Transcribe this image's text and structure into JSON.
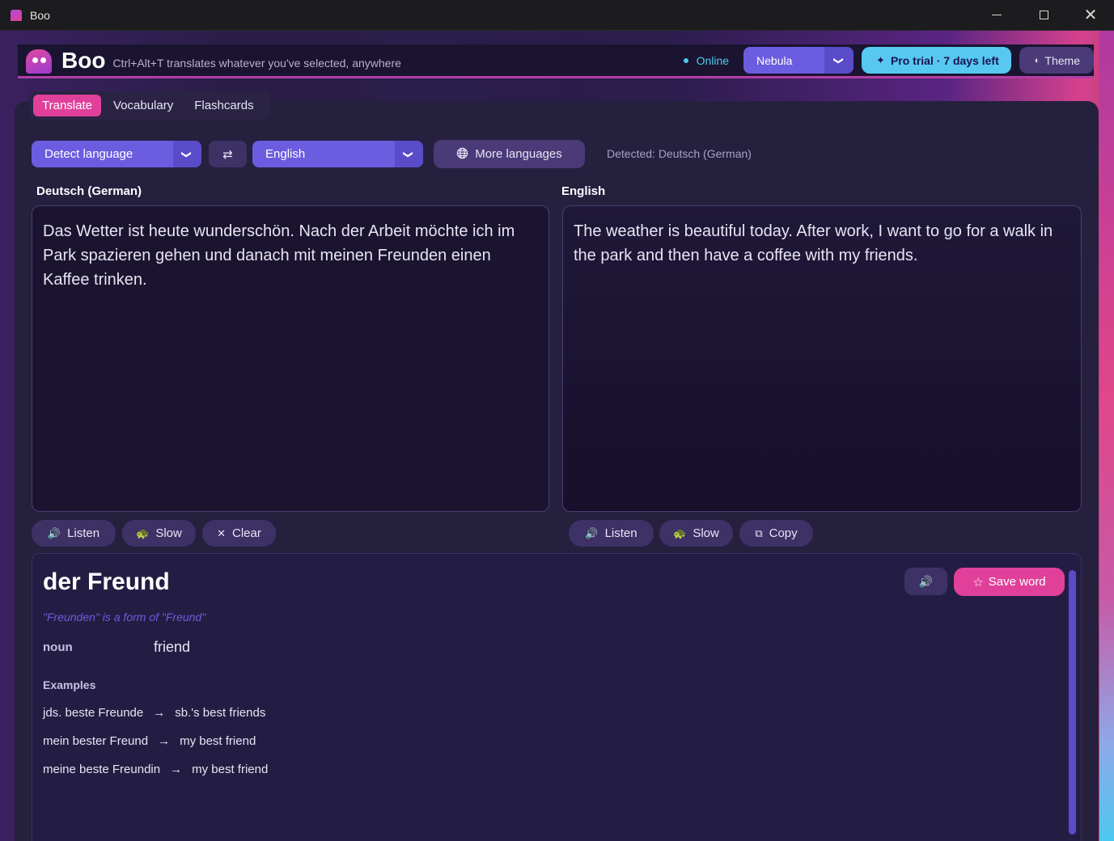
{
  "window": {
    "title": "Boo",
    "controls": {
      "minimize": "minimize-icon",
      "maximize": "maximize-icon",
      "close": "✕"
    }
  },
  "header": {
    "brand": "Boo",
    "tagline": "Ctrl+Alt+T translates whatever you've selected, anywhere",
    "status": "Online",
    "theme_select": "Nebula",
    "pro_label": "Pro trial · 7 days left",
    "theme_button": "Theme",
    "icons": {
      "spark": "✦",
      "half_circle": "◐",
      "chevron": "❯"
    }
  },
  "tabs": [
    {
      "label": "Translate",
      "active": true
    },
    {
      "label": "Vocabulary",
      "active": false
    },
    {
      "label": "Flashcards",
      "active": false
    }
  ],
  "lang_bar": {
    "source": "Detect language",
    "swap": "⇄",
    "target": "English",
    "more_languages": "More languages",
    "detected": "Detected: Deutsch (German)"
  },
  "source": {
    "label": "Deutsch (German)",
    "text": "Das Wetter ist heute wunderschön. Nach der Arbeit möchte ich im Park spazieren gehen und danach mit meinen Freunden einen Kaffee trinken.",
    "buttons": {
      "listen": "Listen",
      "slow": "Slow",
      "clear": "Clear"
    }
  },
  "target": {
    "label": "English",
    "text": "The weather is beautiful today. After work, I want to go for a walk in the park and then have a coffee with my friends.",
    "buttons": {
      "listen": "Listen",
      "slow": "Slow",
      "copy": "Copy"
    }
  },
  "dictionary": {
    "headword": "der Freund",
    "form_note": "\"Freunden\" is a form of \"Freund\"",
    "pos": "noun",
    "gloss": "friend",
    "save_word": "Save word",
    "examples_title": "Examples",
    "examples": [
      {
        "de": "jds. beste Freunde",
        "en": "sb.'s best friends"
      },
      {
        "de": "mein bester Freund",
        "en": "my best friend"
      },
      {
        "de": "meine beste Freundin",
        "en": "my best friend"
      }
    ],
    "arrow": "→"
  },
  "colors": {
    "accent_pink": "#e0409a",
    "accent_purple": "#6c5ce0",
    "accent_cyan": "#56c8f2",
    "panel": "#26203f"
  }
}
